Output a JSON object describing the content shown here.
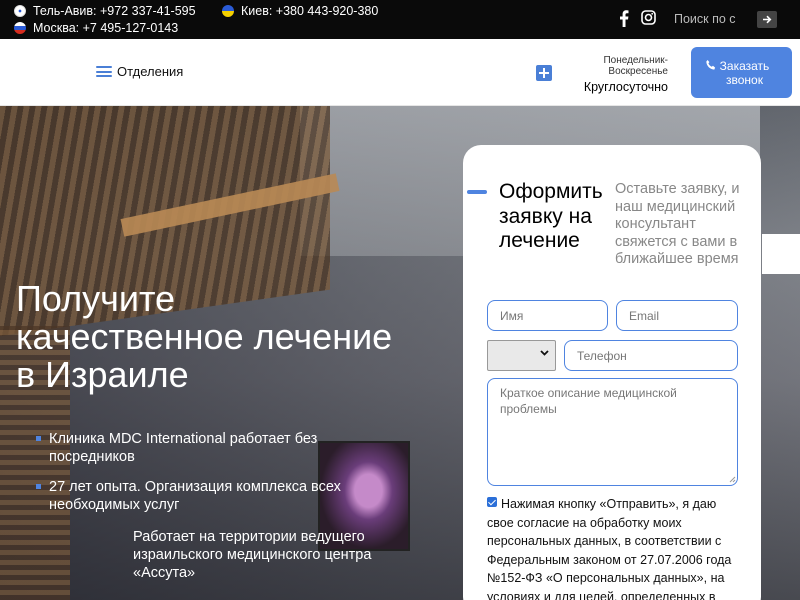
{
  "topbar": {
    "contacts": [
      {
        "city_phone": "Тель-Авив: +972 337-41-595"
      },
      {
        "city_phone": "Киев: +380 443-920-380"
      },
      {
        "city_phone": "Москва: +7 495-127-0143"
      }
    ],
    "search_placeholder": "Поиск по с"
  },
  "header": {
    "menu_label": "Отделения",
    "hours_days": "Понедельник-Воскресенье",
    "hours_mode": "Круглосуточно",
    "call_button": "Заказать звонок"
  },
  "hero": {
    "title": "Получите качественное лечение в Израиле",
    "bullets": [
      "Клиника MDC International работает без посредников",
      "27 лет опыта. Организация комплекса всех необходимых услуг",
      "Работает на территории ведущего израильского медицинского центра «Ассута»"
    ]
  },
  "form": {
    "title": "Оформить заявку на лечение",
    "subtitle": "Оставьте заявку, и наш медицинский консультант свяжется с вами в ближайшее время",
    "name_placeholder": "Имя",
    "email_placeholder": "Email",
    "phone_placeholder": "Телефон",
    "description_placeholder": "Краткое описание медицинской проблемы",
    "consent_checked": true,
    "consent_text": "Нажимая кнопку «Отправить», я даю свое согласие на обработку моих персональных данных, в соответствии с Федеральным законом от 27.07.2006 года №152-ФЗ «О персональных данных», на условиях и для целей, определенных в"
  },
  "colors": {
    "accent": "#4f84e0",
    "topbar_bg": "#0a0a0a"
  }
}
